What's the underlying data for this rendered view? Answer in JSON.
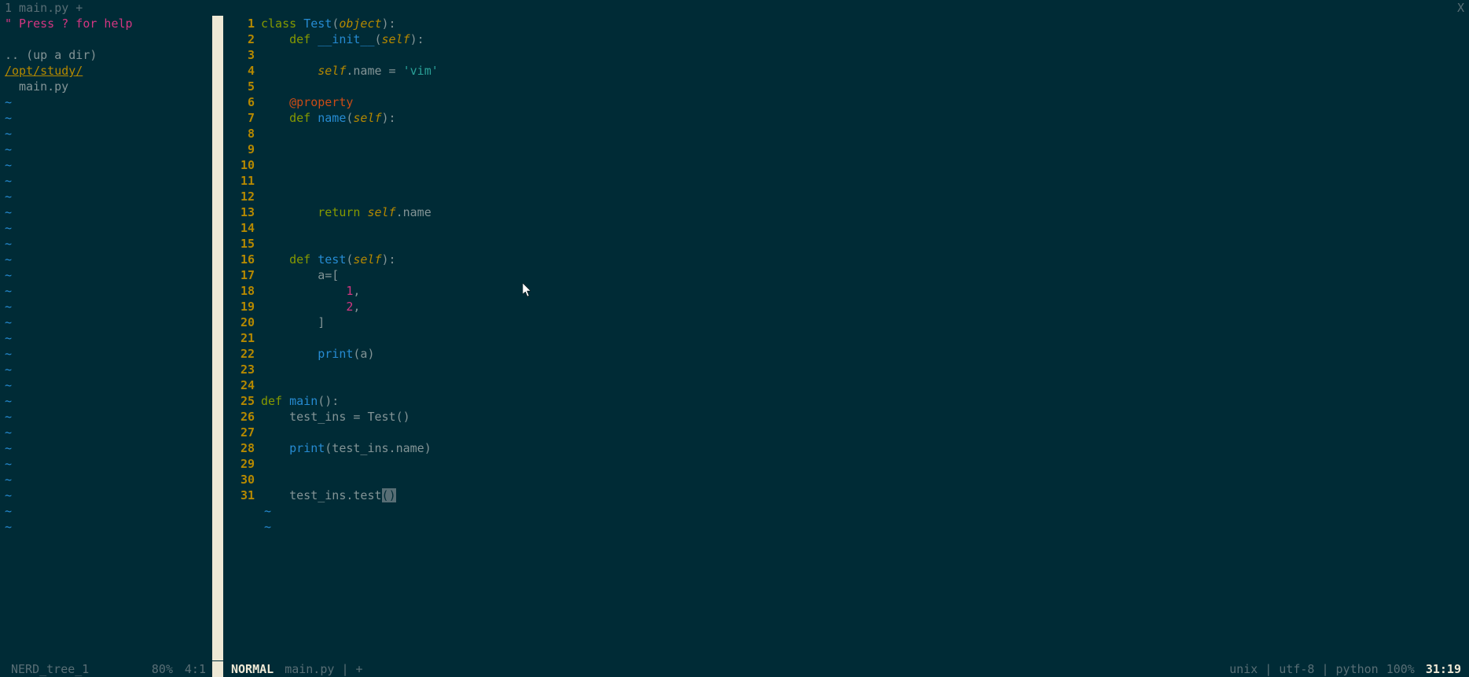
{
  "tabline": {
    "tab1": "1 main.py +",
    "close": "X"
  },
  "nerdtree": {
    "help": "\" Press ? for help",
    "up": ".. (up a dir)",
    "root": "/opt/study/",
    "file1": "main.py"
  },
  "gutter": [
    "1",
    "2",
    "3",
    "4",
    "5",
    "6",
    "7",
    "8",
    "9",
    "10",
    "11",
    "12",
    "13",
    "14",
    "15",
    "16",
    "17",
    "18",
    "19",
    "20",
    "21",
    "22",
    "23",
    "24",
    "25",
    "26",
    "27",
    "28",
    "29",
    "30",
    "31"
  ],
  "code": {
    "l1_kw": "class ",
    "l1_cls": "Test",
    "l1_p1": "(",
    "l1_bi": "object",
    "l1_p2": "):",
    "l2_kw": "def ",
    "l2_fn": "__init__",
    "l2_p1": "(",
    "l2_bi": "self",
    "l2_p2": "):",
    "l4_bi": "self",
    "l4_mid": ".name = ",
    "l4_str": "'vim'",
    "l6_dec": "@property",
    "l7_kw": "def ",
    "l7_fn": "name",
    "l7_p1": "(",
    "l7_bi": "self",
    "l7_p2": "):",
    "l13_kw": "return ",
    "l13_bi": "self",
    "l13_rest": ".name",
    "l16_kw": "def ",
    "l16_fn": "test",
    "l16_p1": "(",
    "l16_bi": "self",
    "l16_p2": "):",
    "l17": "a=[",
    "l18_num": "1",
    "l18_c": ",",
    "l19_num": "2",
    "l19_c": ",",
    "l20": "]",
    "l22_fn": "print",
    "l22_rest": "(a)",
    "l25_kw": "def ",
    "l25_fn": "main",
    "l25_p": "():",
    "l26": "test_ins = Test()",
    "l28_fn": "print",
    "l28_rest": "(test_ins.name)",
    "l31_pre": "test_ins.test",
    "l31_open": "(",
    "l31_close": ")"
  },
  "status_left": {
    "name": "NERD_tree_1",
    "pct": "80%",
    "pos": "4:1"
  },
  "status_right": {
    "mode": "NORMAL",
    "file": "main.py ",
    "sep": "|",
    "modified": " +",
    "info": "unix | utf-8 | python",
    "pct": "100%",
    "pos": "31:19"
  }
}
